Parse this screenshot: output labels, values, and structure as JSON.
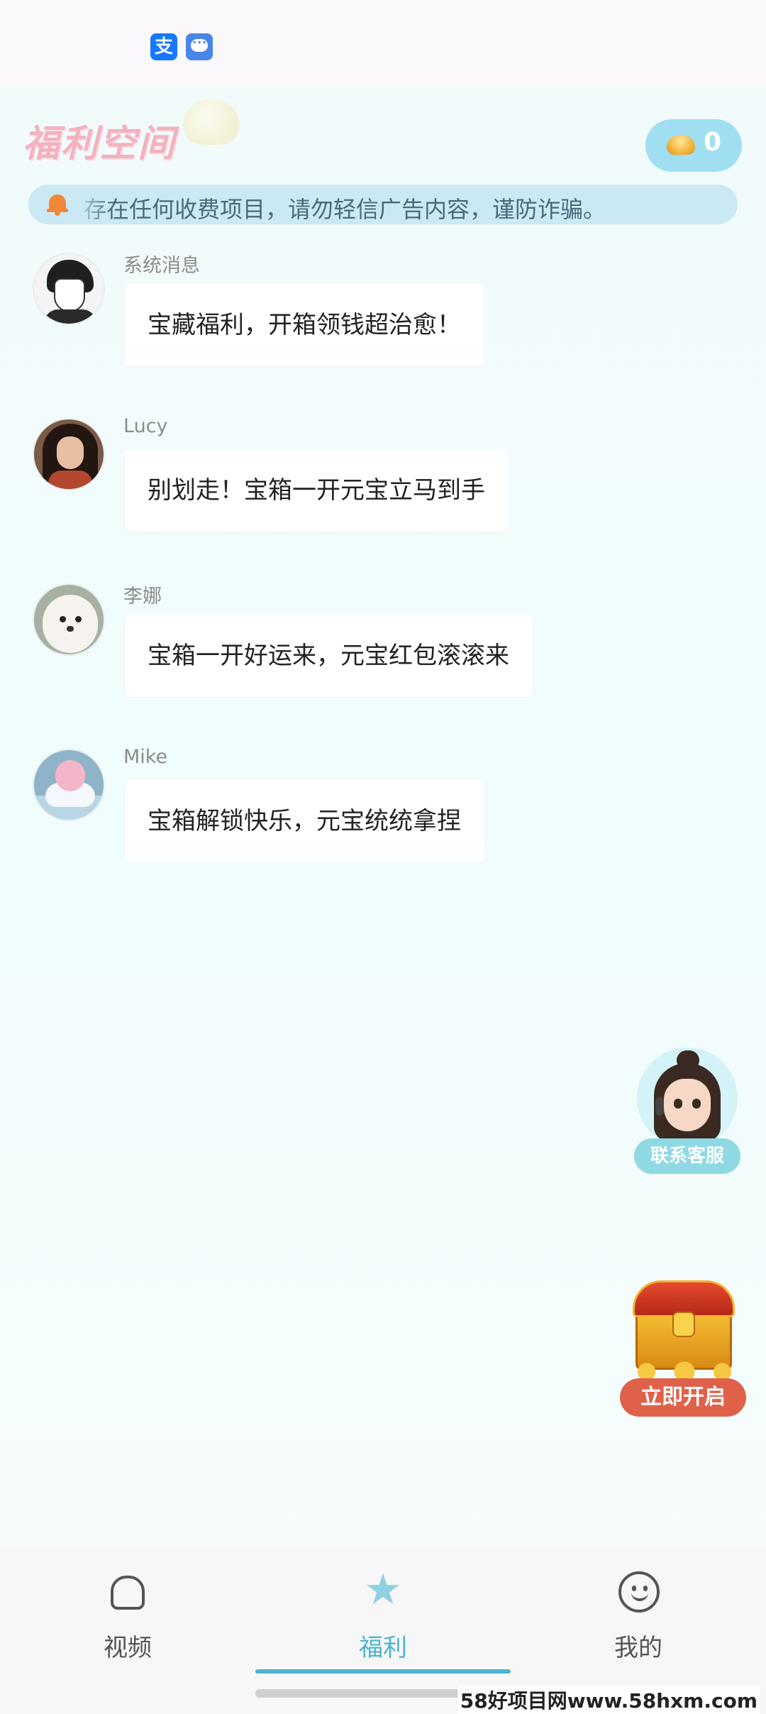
{
  "status_bar": {
    "icons": [
      "alipay-icon",
      "message-icon"
    ],
    "alipay_glyph": "支"
  },
  "header": {
    "logo_text": "福利空间",
    "coin_count": "0"
  },
  "notice": {
    "text": "存在任何收费项目，请勿轻信广告内容，谨防诈骗。"
  },
  "messages": [
    {
      "sender": "系统消息",
      "text": "宝藏福利，开箱领钱超治愈！"
    },
    {
      "sender": "Lucy",
      "text": "别划走！宝箱一开元宝立马到手"
    },
    {
      "sender": "李娜",
      "text": "宝箱一开好运来，元宝红包滚滚来"
    },
    {
      "sender": "Mike",
      "text": "宝箱解锁快乐，元宝统统拿捏"
    }
  ],
  "customer_service": {
    "label": "联系客服"
  },
  "treasure": {
    "label": "立即开启"
  },
  "bottom_nav": {
    "items": [
      {
        "label": "视频",
        "icon": "home-icon"
      },
      {
        "label": "福利",
        "icon": "star-icon",
        "active": true
      },
      {
        "label": "我的",
        "icon": "smile-icon"
      }
    ]
  },
  "watermark": "58好项目网www.58hxm.com",
  "colors": {
    "accent": "#4cb3d0",
    "background": "#f2fbfb",
    "treasure_button": "#e0614a",
    "cs_button": "#8fd9e3"
  }
}
